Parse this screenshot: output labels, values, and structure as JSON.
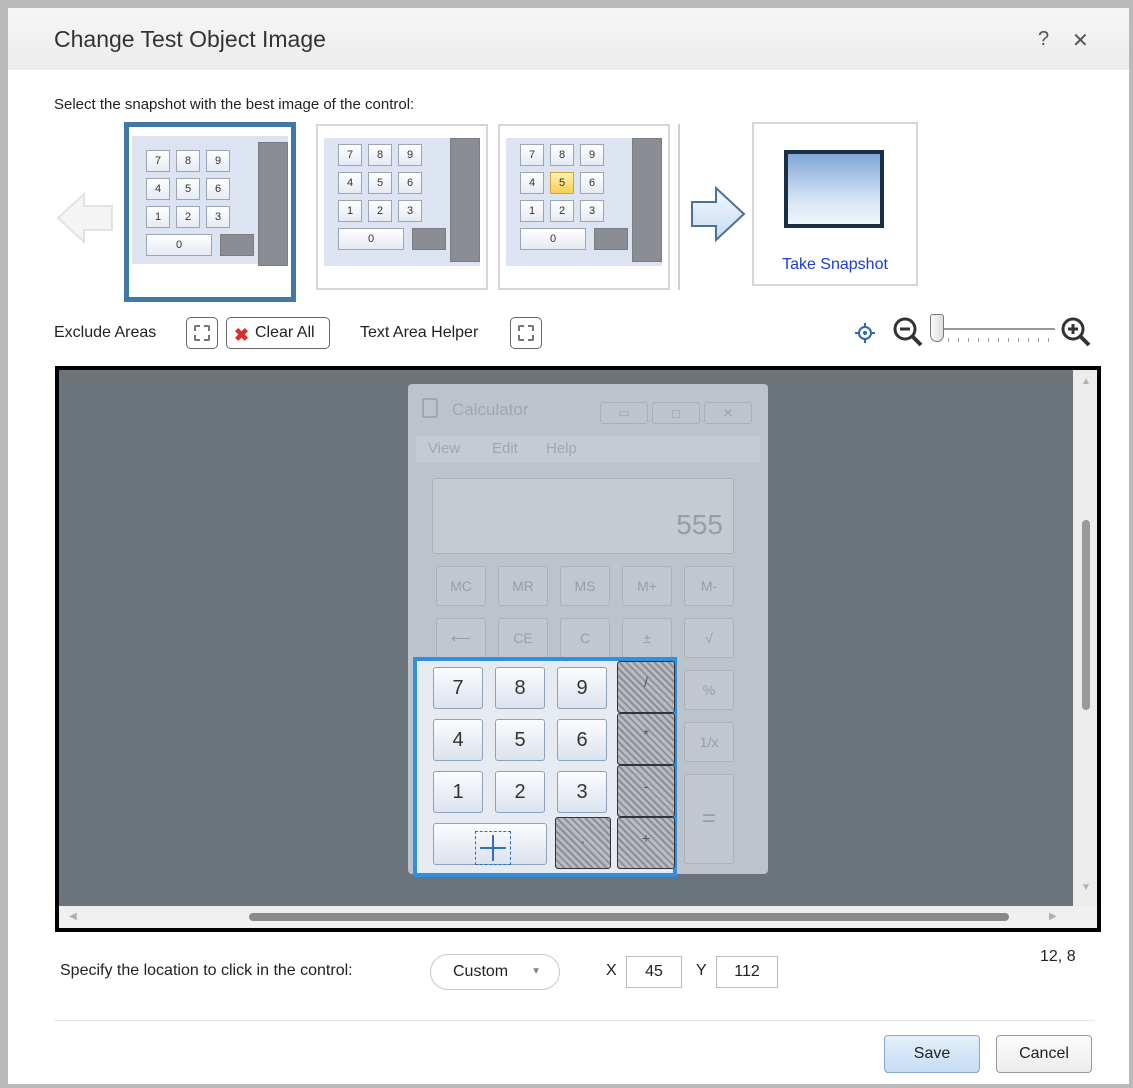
{
  "dialog": {
    "title": "Change Test Object Image",
    "help": "?",
    "close": "✕"
  },
  "instruction": "Select the snapshot with the best image of the control:",
  "snapshots": {
    "selected_index": 0,
    "take_snapshot_label": "Take Snapshot",
    "keys": [
      [
        "7",
        "8",
        "9",
        "/"
      ],
      [
        "4",
        "5",
        "6",
        "*"
      ],
      [
        "1",
        "2",
        "3",
        "-"
      ],
      [
        "0",
        ".",
        "+"
      ]
    ],
    "highlight_key_in_third": "5"
  },
  "toolbar": {
    "exclude_areas_label": "Exclude Areas",
    "clear_all_label": "Clear All",
    "text_area_helper_label": "Text Area Helper"
  },
  "calculator": {
    "title": "Calculator",
    "menu": [
      "View",
      "Edit",
      "Help"
    ],
    "display_value": "555",
    "memory_row": [
      "MC",
      "MR",
      "MS",
      "M+",
      "M-"
    ],
    "edit_row": [
      "⟵",
      "CE",
      "C",
      "±",
      "√"
    ],
    "side_keys": [
      "%",
      "1/x",
      "="
    ],
    "digit_rows": [
      [
        "7",
        "8",
        "9",
        "/"
      ],
      [
        "4",
        "5",
        "6",
        "*"
      ],
      [
        "1",
        "2",
        "3",
        "-"
      ]
    ],
    "bottom_row": [
      "",
      ".",
      "+"
    ]
  },
  "footer": {
    "click_location_label": "Specify the location to click in the control:",
    "click_location_value": "Custom",
    "x_label": "X",
    "x_value": "45",
    "y_label": "Y",
    "y_value": "112",
    "coords_readout": "12, 8",
    "save_label": "Save",
    "cancel_label": "Cancel"
  }
}
